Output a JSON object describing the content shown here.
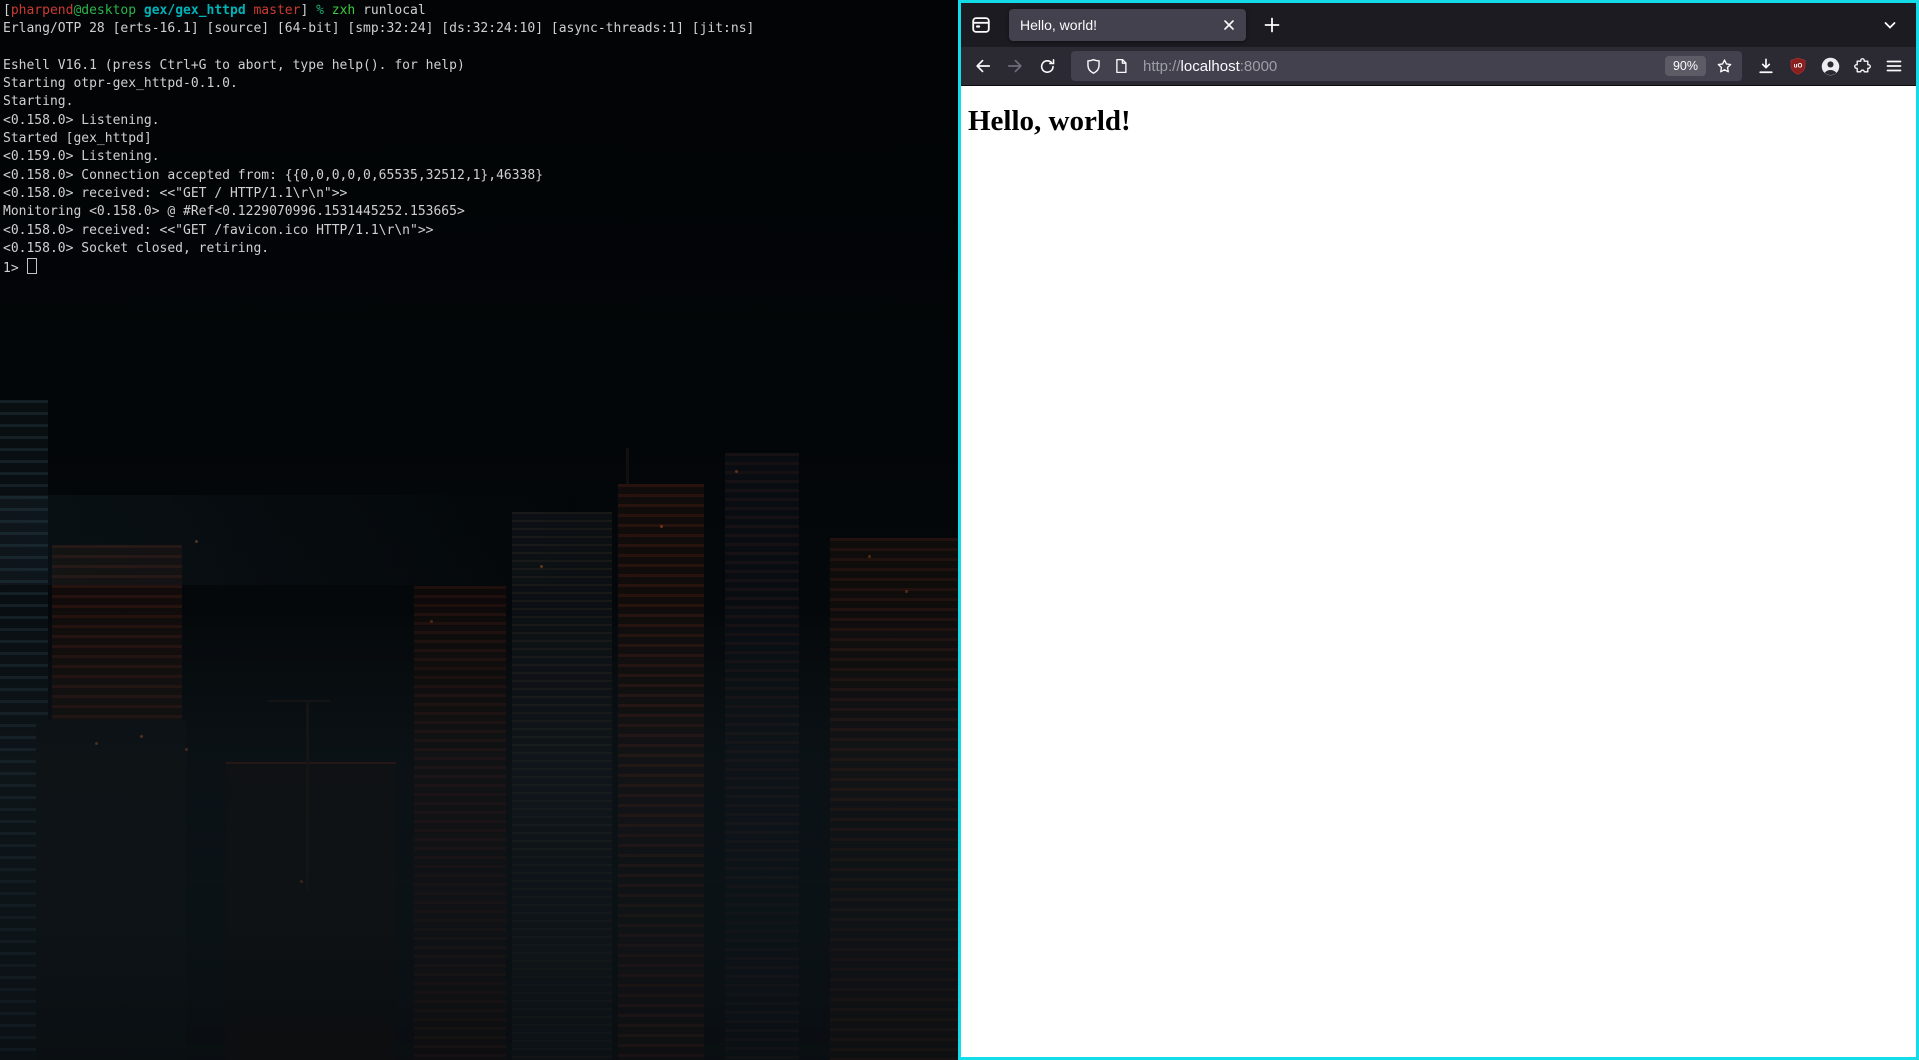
{
  "colors": {
    "window_focus_border": "#14dbe8",
    "terminal_user_red": "#cc3b33",
    "terminal_host_green": "#2db54b",
    "terminal_path_cyan": "#00b3b8",
    "terminal_branch_red": "#cc3b33",
    "terminal_command_green": "#3bcc42",
    "ublock_red": "#8a1f1f",
    "tab_bar_bg": "#1c1b22",
    "toolbar_bg": "#2b2a33",
    "urlbar_bg": "#42414d"
  },
  "terminal": {
    "prompt": {
      "bracket_open": "[",
      "user": "pharpend",
      "host": "@desktop",
      "path": " gex/gex_httpd",
      "branch": " master",
      "bracket_close": "]",
      "percent": " %",
      "command": " zxh",
      "arguments": " runlocal"
    },
    "lines": [
      "Erlang/OTP 28 [erts-16.1] [source] [64-bit] [smp:32:24] [ds:32:24:10] [async-threads:1] [jit:ns]",
      "",
      "Eshell V16.1 (press Ctrl+G to abort, type help(). for help)",
      "Starting otpr-gex_httpd-0.1.0.",
      "Starting.",
      "<0.158.0> Listening.",
      "Started [gex_httpd]",
      "<0.159.0> Listening.",
      "<0.158.0> Connection accepted from: {{0,0,0,0,0,65535,32512,1},46338}",
      "<0.158.0> received: <<\"GET / HTTP/1.1\\r\\n\">>",
      "Monitoring <0.158.0> @ #Ref<0.1229070996.1531445252.153665>",
      "<0.158.0> received: <<\"GET /favicon.ico HTTP/1.1\\r\\n\">>",
      "<0.158.0> Socket closed, retiring."
    ],
    "shell_prompt": "1> "
  },
  "browser": {
    "tab_title": "Hello, world!",
    "url": {
      "scheme": "http://",
      "host": "localhost",
      "port": ":8000"
    },
    "zoom_level": "90%",
    "page_heading": "Hello, world!"
  }
}
